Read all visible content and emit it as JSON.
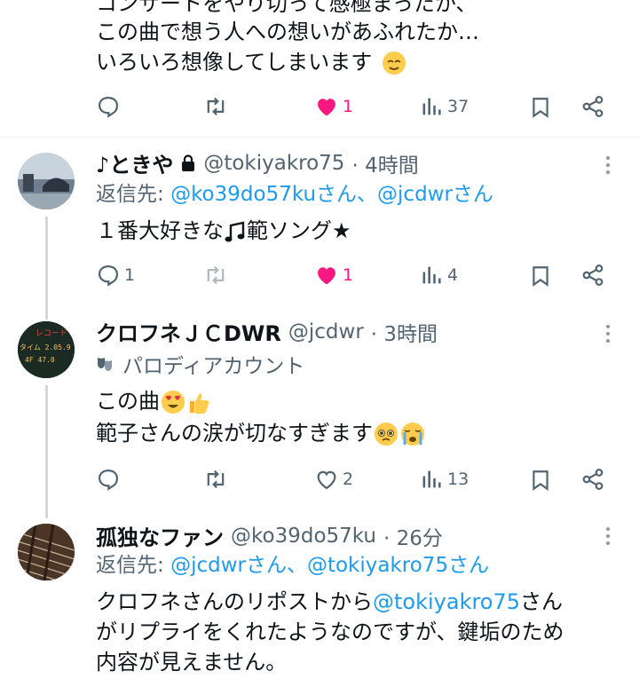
{
  "tweet0": {
    "line1": "コンサートをやり切って感極まったか、",
    "line2": "この曲で想う人への想いがあふれたか…",
    "line3": "いろいろ想像してしまいます",
    "likes": "1",
    "views": "37"
  },
  "tweet1": {
    "name": "♪ときや",
    "handle": "@tokiyakro75",
    "time": "· 4時間",
    "reply_prefix": "返信先: ",
    "reply_to": "@ko39do57kuさん、@jcdwrさん",
    "text_part1": "１番大好きな",
    "text_part2": "範ソング★",
    "replies": "1",
    "likes": "1",
    "views": "4"
  },
  "tweet2": {
    "name": "クロフネＪＣDWR",
    "handle": "@jcdwr",
    "time": "· 3時間",
    "label": "パロディアカウント",
    "line1": "この曲",
    "line2": "範子さんの涙が切なすぎます",
    "avatar_text1": "レコード",
    "avatar_text2": "タイム 2.05.9",
    "avatar_text3": "4F  47.0",
    "likes": "2",
    "views": "13"
  },
  "tweet3": {
    "name": "孤独なファン",
    "handle": "@ko39do57ku",
    "time": "· 26分",
    "reply_prefix": "返信先: ",
    "reply_to": "@jcdwrさん、@tokiyakro75さん",
    "line1_a": "クロフネさんのリポストから",
    "line1_link": "@tokiyakro75",
    "line1_b": "さん",
    "line2": "がリプライをくれたようなのですが、鍵垢のため",
    "line3": "内容が見えません。"
  },
  "colors": {
    "like": "#f91880",
    "link": "#1d9bf0",
    "muted": "#536471",
    "divider": "#eff3f4"
  },
  "icons": [
    "reply-icon",
    "retweet-icon",
    "heart-icon",
    "views-icon",
    "bookmark-icon",
    "share-icon",
    "lock-icon",
    "kebab-icon",
    "parody-mask-icon"
  ]
}
